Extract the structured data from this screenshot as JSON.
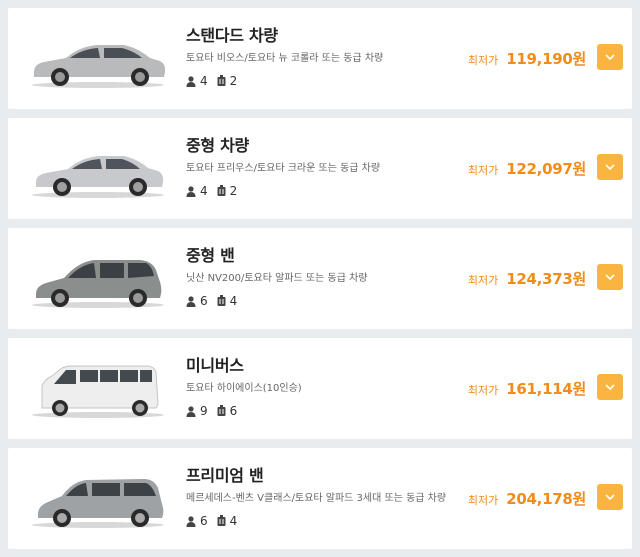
{
  "vehicles": [
    {
      "name": "스탠다드 차량",
      "desc": "토요타 비오스/토요타 뉴 코롤라 또는 동급 차량",
      "passengers": "4",
      "luggage": "2",
      "price_label": "최저가",
      "price": "119,190원",
      "car_icon": "sedan-icon",
      "car_color": "#b9babc"
    },
    {
      "name": "중형 차량",
      "desc": "토요타 프리우스/토요타 크라운 또는 동급 차량",
      "passengers": "4",
      "luggage": "2",
      "price_label": "최저가",
      "price": "122,097원",
      "car_icon": "sedan-icon",
      "car_color": "#c7c9cc"
    },
    {
      "name": "중형 밴",
      "desc": "닛산 NV200/토요타 알파드 또는 동급 차량",
      "passengers": "6",
      "luggage": "4",
      "price_label": "최저가",
      "price": "124,373원",
      "car_icon": "minivan-icon",
      "car_color": "#8a8e8c"
    },
    {
      "name": "미니버스",
      "desc": "토요타 하이에이스(10인승)",
      "passengers": "9",
      "luggage": "6",
      "price_label": "최저가",
      "price": "161,114원",
      "car_icon": "minibus-icon",
      "car_color": "#eeeeee"
    },
    {
      "name": "프리미엄 밴",
      "desc": "메르세데스-벤츠 V클래스/토요타 알파드 3세대 또는 동급 차량",
      "passengers": "6",
      "luggage": "4",
      "price_label": "최저가",
      "price": "204,178원",
      "car_icon": "van-icon",
      "car_color": "#9fa2a4"
    }
  ],
  "colors": {
    "accent": "#f08c1a",
    "button": "#f9b53f"
  },
  "icons": {
    "passengers": "person-icon",
    "luggage": "luggage-icon",
    "expand": "chevron-down-icon"
  }
}
